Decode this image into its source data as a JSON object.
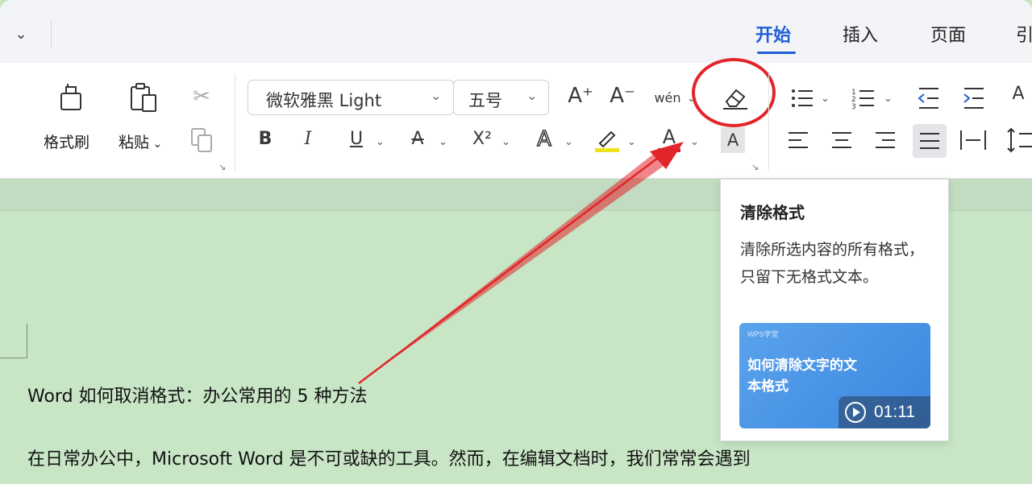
{
  "tabs": [
    {
      "label": "开始",
      "active": true
    },
    {
      "label": "插入"
    },
    {
      "label": "页面"
    },
    {
      "label": "引"
    }
  ],
  "ribbon": {
    "format_painter": "格式刷",
    "paste": "粘贴",
    "font_name": "微软雅黑 Light",
    "font_size": "五号",
    "bold": "B",
    "italic": "I",
    "underline": "U",
    "strike": "A",
    "superscript": "X²",
    "grow_font": "A⁺",
    "shrink_font": "A⁻",
    "phonetic": "wén",
    "char_shading": "A"
  },
  "tooltip": {
    "title": "清除格式",
    "description": "清除所选内容的所有格式，只留下无格式文本。",
    "video_brand": "WPS学堂",
    "video_title": "如何清除文字的文本格式",
    "video_duration": "01:11"
  },
  "document": {
    "heading": "Word 如何取消格式：办公常用的 5 种方法",
    "paragraph": "在日常办公中，Microsoft Word 是不可或缺的工具。然而，在编辑文档时，我们常常会遇到"
  },
  "colors": {
    "accent": "#1f5ed6",
    "annotation": "#e2252a",
    "document_bg": "#c8e6c6"
  }
}
